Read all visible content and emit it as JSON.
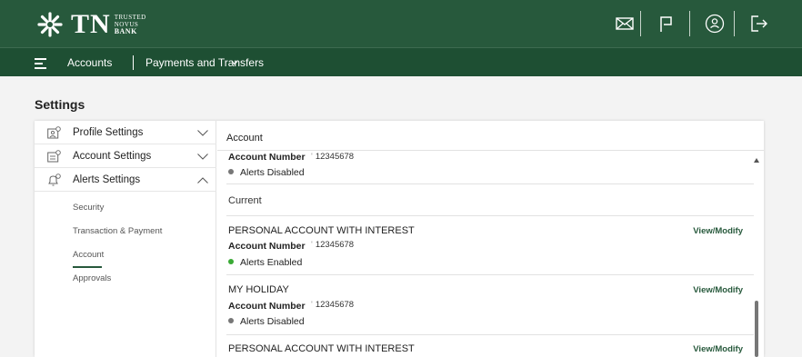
{
  "header": {
    "logo": {
      "mark": "snowflake-logo-mark",
      "name": "TN",
      "line1": "TRUSTED",
      "line2": "NOVUS",
      "line3": "BANK"
    },
    "icons": [
      "mail-icon",
      "flag-icon",
      "user-icon",
      "logout-icon"
    ]
  },
  "nav": {
    "menu_icon": "menu-icon",
    "accounts": "Accounts",
    "payments": "Payments and Transfers"
  },
  "page": {
    "title": "Settings"
  },
  "sidebar": {
    "items": [
      {
        "label": "Profile Settings",
        "icon": "profile-settings-icon",
        "expanded": false
      },
      {
        "label": "Account Settings",
        "icon": "account-settings-icon",
        "expanded": false
      },
      {
        "label": "Alerts Settings",
        "icon": "alerts-settings-icon",
        "expanded": true
      }
    ],
    "sub_items": [
      "Security",
      "Transaction & Payment",
      "Account",
      "Approvals"
    ],
    "active_sub": "Account"
  },
  "content": {
    "heading": "Account",
    "partial_row": {
      "number_label": "Account Number",
      "number": "12345678",
      "status": "Alerts Disabled"
    },
    "group_label": "Current",
    "accounts": [
      {
        "name": "PERSONAL ACCOUNT WITH INTEREST",
        "number_label": "Account Number",
        "number": "12345678",
        "status": "Alerts Enabled",
        "action": "View/Modify"
      },
      {
        "name": "MY HOLIDAY",
        "number_label": "Account Number",
        "number": "12345678",
        "status": "Alerts Disabled",
        "action": "View/Modify"
      },
      {
        "name": "PERSONAL ACCOUNT WITH INTEREST",
        "action": "View/Modify"
      }
    ]
  },
  "colors": {
    "brand_green": "#27593c",
    "nav_green": "#1e4f33",
    "enabled": "#3aaa35",
    "disabled": "#777777"
  }
}
